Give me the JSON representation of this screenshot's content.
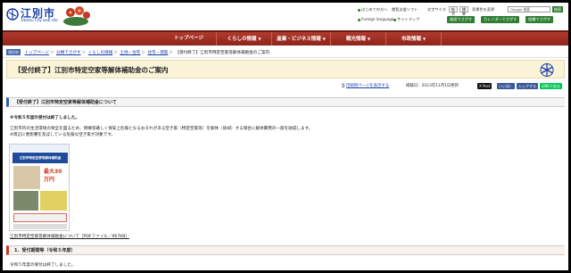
{
  "header": {
    "logo_text": "江別市",
    "logo_sub": "Ebetsu City web site",
    "util_links": [
      "はじめての方へ",
      "Foreign language",
      "サイトマップ"
    ],
    "util_links_row1_extra": [
      "閲覧支援ソフト",
      "文字サイズ",
      "背景色を変更"
    ],
    "font_size_label": "文字サイズ",
    "font_sizes": [
      "拡大",
      "標準"
    ],
    "search_label": "Google 検索",
    "search_button": "検索",
    "quick_buttons": [
      "施設でさがす",
      "カレンダーでさがす",
      "組織でさがす"
    ]
  },
  "nav": {
    "items": [
      "トップページ",
      "くらしの情報",
      "産業・ビジネス情報",
      "観光情報",
      "市政情報"
    ]
  },
  "breadcrumb": {
    "badge": "現在地",
    "items": [
      "トップページ",
      "分類でさがす",
      "くらしの情報",
      "土地・住宅",
      "住宅・建築",
      "【受付終了】江別市特定空家等解体補助金のご案内"
    ]
  },
  "page": {
    "title": "【受付終了】江別市特定空家等解体補助金のご案内",
    "print_link": "印刷用ページを表示する",
    "published": "掲載日：2023年11月1日更新",
    "share_buttons": [
      "X Post",
      "いいね！",
      "シェアする",
      "LINEで送る"
    ],
    "section1": "【受付終了】江別市特定空家等解体補助金について",
    "notice": "※令和５年度の受付は終了しました。",
    "para1": "江別市内の生活環境の保全を図るため、倒壊等著しく保安上危険となるおそれがある空き家（特定空家等）を解体（除却）する場合に解体費用の一部を助成します。",
    "para2": "※周辺に悪影響を及ぼしている危険な空き家が対象です。",
    "leaflet_title": "江別市特定空家等解体補助金",
    "leaflet_amount": "最大30万円",
    "pdf_link": "江別市特定空家等解体補助金について［PDFファイル／967KB］",
    "section2": "1．受付期間等（令和５年度）",
    "closed": "令和５年度の受付は終了しました。"
  },
  "colors": {
    "nav_bg": "#a8342a",
    "link": "#1a3fa8",
    "title_bg": "#faf3d8",
    "green": "#2e7d32"
  }
}
